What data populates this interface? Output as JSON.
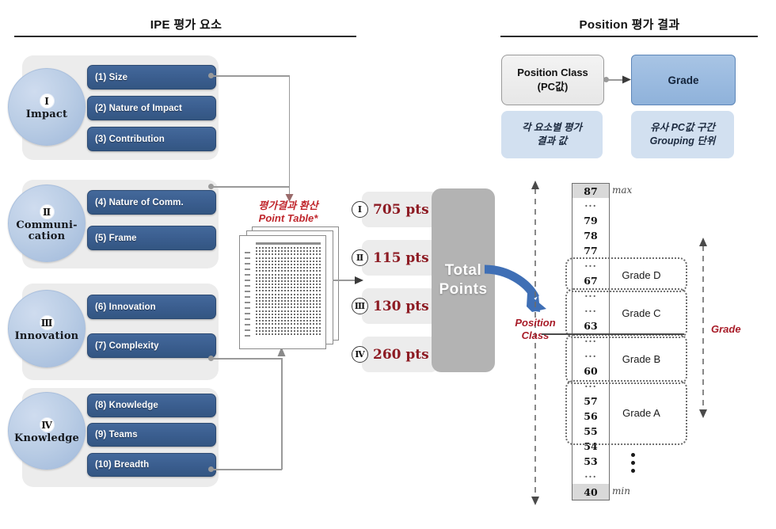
{
  "sections": {
    "left_title": "IPE 평가 요소",
    "right_title": "Position 평가 결과"
  },
  "categories": [
    {
      "roman": "Ⅰ",
      "name": "Impact",
      "elements": [
        "(1) Size",
        "(2) Nature of Impact",
        "(3) Contribution"
      ]
    },
    {
      "roman": "Ⅱ",
      "name": "Communi-\ncation",
      "name_line1": "Communi-",
      "name_line2": "cation",
      "elements": [
        "(4) Nature of Comm.",
        "(5) Frame"
      ]
    },
    {
      "roman": "Ⅲ",
      "name": "Innovation",
      "elements": [
        "(6) Innovation",
        "(7) Complexity"
      ]
    },
    {
      "roman": "Ⅳ",
      "name": "Knowledge",
      "elements": [
        "(8) Knowledge",
        "(9) Teams",
        "(10) Breadth"
      ]
    }
  ],
  "point_table": {
    "label_line1": "평가결과 환산",
    "label_line2": "Point Table*"
  },
  "points": [
    {
      "roman": "Ⅰ",
      "value": "705 pts"
    },
    {
      "roman": "Ⅱ",
      "value": "115 pts"
    },
    {
      "roman": "Ⅲ",
      "value": "130 pts"
    },
    {
      "roman": "Ⅳ",
      "value": "260 pts"
    }
  ],
  "total": {
    "line1": "Total",
    "line2": "Points"
  },
  "right_panel": {
    "position_class_line1": "Position Class",
    "position_class_line2": "(PC값)",
    "grade_label": "Grade",
    "note_pc_line1": "각 요소별 평가",
    "note_pc_line2": "결과 값",
    "note_grade_line1": "유사 PC값 구간",
    "note_grade_line2": "Grouping 단위"
  },
  "axis_labels": {
    "position_class_line1": "Position",
    "position_class_line2": "Class",
    "grade": "Grade"
  },
  "ladder": {
    "max_marker": "max",
    "min_marker": "min",
    "cells": [
      {
        "text": "87",
        "shaded": true
      },
      {
        "text": "···",
        "ellipsis": true
      },
      {
        "text": "79"
      },
      {
        "text": "78"
      },
      {
        "text": "77"
      },
      {
        "text": "···",
        "ellipsis": true
      },
      {
        "text": "67"
      },
      {
        "text": "···",
        "ellipsis": true
      },
      {
        "text": "···",
        "ellipsis": true
      },
      {
        "text": "63"
      },
      {
        "text": "···",
        "ellipsis": true
      },
      {
        "text": "···",
        "ellipsis": true
      },
      {
        "text": "60"
      },
      {
        "text": "···",
        "ellipsis": true
      },
      {
        "text": "57"
      },
      {
        "text": "56"
      },
      {
        "text": "55"
      },
      {
        "text": "54"
      },
      {
        "text": "53"
      },
      {
        "text": "···",
        "ellipsis": true
      },
      {
        "text": "40",
        "shaded": true
      }
    ],
    "grades": [
      {
        "label": "Grade D"
      },
      {
        "label": "Grade C"
      },
      {
        "label": "Grade B"
      },
      {
        "label": "Grade A"
      }
    ]
  },
  "colors": {
    "element_blue": "#3a5d8e",
    "circle_blue": "#bacde5",
    "group_gray": "#ececec",
    "points_red": "#8d1b23",
    "accent_red": "#c0272d",
    "total_gray": "#b3b3b3",
    "grade_blue": "#9bbbe0",
    "note_blue": "#d2e0f0",
    "arrow_blue": "#3f6fb5"
  }
}
